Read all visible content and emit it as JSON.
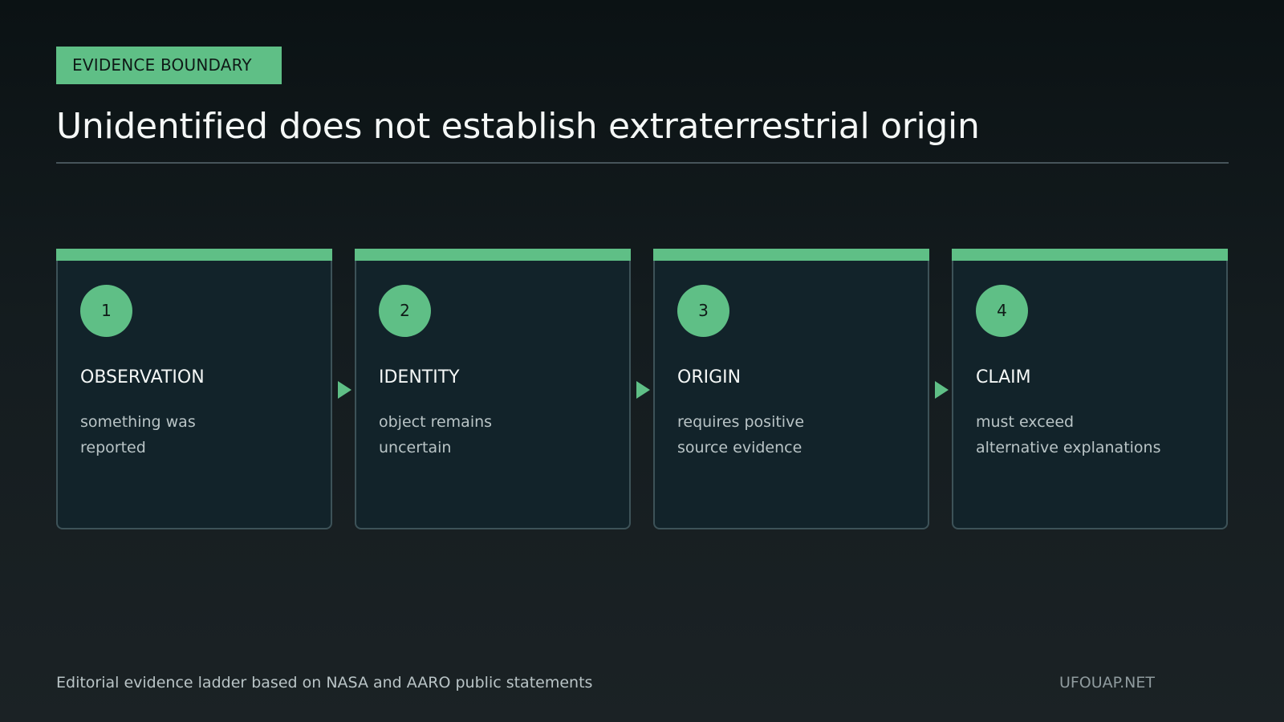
{
  "header": {
    "badge": "EVIDENCE BOUNDARY",
    "title": "Unidentified does not establish extraterrestrial origin"
  },
  "steps": [
    {
      "number": "1",
      "title": "OBSERVATION",
      "description": "something was\nreported"
    },
    {
      "number": "2",
      "title": "IDENTITY",
      "description": "object remains\nuncertain"
    },
    {
      "number": "3",
      "title": "ORIGIN",
      "description": "requires positive\nsource evidence"
    },
    {
      "number": "4",
      "title": "CLAIM",
      "description": "must exceed\nalternative explanations"
    }
  ],
  "footer": {
    "note": "Editorial evidence ladder based on NASA and AARO public statements",
    "brand": "UFOUAP.NET"
  },
  "colors": {
    "accent": "#5fbf86",
    "card_background": "#12232a",
    "card_border": "#3d5258"
  }
}
